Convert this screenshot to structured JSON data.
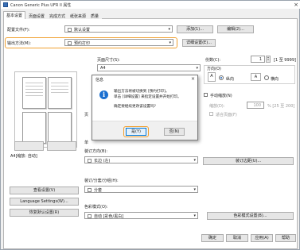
{
  "window": {
    "title": "Canon Generic Plus UFR II 属性",
    "close": "×"
  },
  "tabs": [
    "基本设置",
    "页面设置",
    "完成方式",
    "纸张来源",
    "质量"
  ],
  "profile": {
    "label": "配置文件(F):",
    "value": "默认设置",
    "add": "添加(1)...",
    "edit": "编辑(2)..."
  },
  "output": {
    "label": "输出方法(M):",
    "value": "预约打印",
    "details": "详细设置(E)..."
  },
  "page_size": {
    "label": "页面尺寸(S):",
    "value": "A4"
  },
  "copies": {
    "label": "份数(C):",
    "value": "1",
    "range": "[1 至 9999]"
  },
  "orientation": {
    "label": "方向(O)",
    "portrait": "纵向",
    "landscape": "横向"
  },
  "manual_scaling": {
    "label": "手动缩放(N)",
    "scale_label": "缩放(D):",
    "scale_value": "100",
    "range": "% [25 至 200]",
    "fit": "适合页面(F)"
  },
  "preview": {
    "caption": "A4[缩放: 自动]"
  },
  "binding": {
    "label": "装订方向(B):",
    "value": "长边 (左)",
    "margin_btn": "装订边距(U)..."
  },
  "finishing": {
    "label": "装订/分套/分组(H):",
    "value": "分套"
  },
  "color": {
    "label": "色彩模式(O):",
    "value": "自动 [彩色/黑白]",
    "details_btn": "色彩模式设置(B)..."
  },
  "left_buttons": [
    "查看设置(V)",
    "Language Settings(W)...",
    "恢复默认设置(R)"
  ],
  "bottom_buttons": [
    "确定",
    "取消",
    "应用(A)",
    "帮助"
  ],
  "dialog": {
    "title": "信息",
    "line1": "输出方法将被切换到 [预约打印]。",
    "line2": "单击 [详细设置] 来指定设置并开始打印。",
    "line3": "确定要继续更改该设置吗?",
    "yes": "是(Y)",
    "no": "否(N)"
  },
  "colors": {
    "highlight": "#f0a030",
    "info": "#1a6fd0"
  }
}
